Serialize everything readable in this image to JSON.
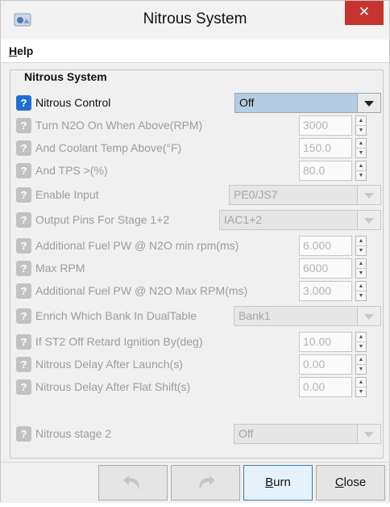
{
  "window": {
    "title": "Nitrous System",
    "close_glyph": "✕"
  },
  "menu": {
    "help_first": "H",
    "help_rest": "elp"
  },
  "group": {
    "title": "Nitrous System"
  },
  "rows": [
    {
      "label": "Nitrous Control",
      "value": "Off"
    },
    {
      "label": "Turn N2O On When Above(RPM)",
      "value": "3000"
    },
    {
      "label": "And Coolant Temp Above(°F)",
      "value": "150.0"
    },
    {
      "label": "And TPS >(%)",
      "value": "80.0"
    },
    {
      "label": "Enable Input",
      "value": "PE0/JS7"
    },
    {
      "label": "Output Pins For Stage 1+2",
      "value": "IAC1+2"
    },
    {
      "label": "Additional Fuel PW @ N2O min rpm(ms)",
      "value": "6.000"
    },
    {
      "label": "Max RPM",
      "value": "6000"
    },
    {
      "label": "Additional Fuel PW @ N2O Max RPM(ms)",
      "value": "3.000"
    },
    {
      "label": "Enrich Which Bank In DualTable",
      "value": "Bank1"
    },
    {
      "label": "If ST2 Off Retard Ignition By(deg)",
      "value": "10.00"
    },
    {
      "label": "Nitrous Delay After Launch(s)",
      "value": "0.00"
    },
    {
      "label": "Nitrous Delay After Flat Shift(s)",
      "value": "0.00"
    },
    {
      "label": "Nitrous stage 2",
      "value": "Off"
    }
  ],
  "help_glyph": "?",
  "footer": {
    "undo_icon": "undo-arrow-icon",
    "redo_icon": "redo-arrow-icon",
    "burn_first": "B",
    "burn_rest": "urn",
    "close_first": "C",
    "close_rest": "lose"
  },
  "colors": {
    "accent": "#1f6fd1",
    "close": "#c7342f",
    "selected_combo": "#b5cde3"
  }
}
